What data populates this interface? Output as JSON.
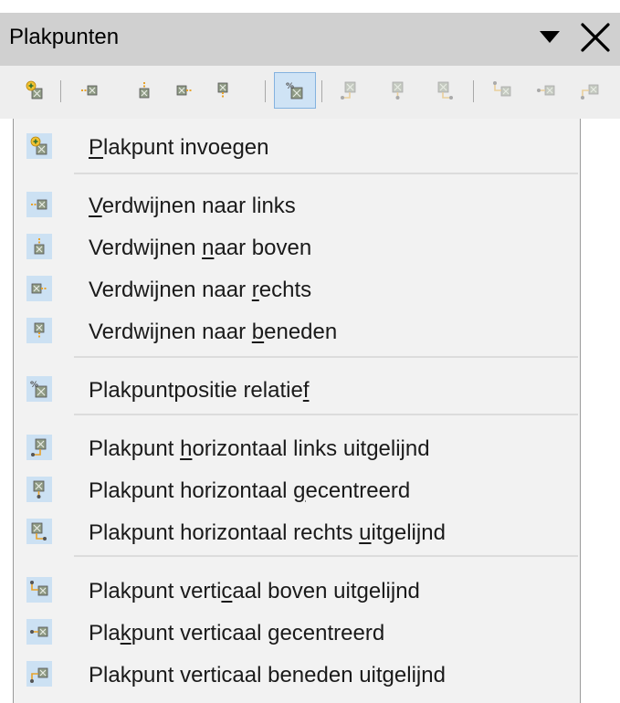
{
  "window": {
    "title": "Plakpunten",
    "dropdown_icon": "triangle-down-icon",
    "close_icon": "close-icon"
  },
  "toolbar": {
    "buttons": [
      {
        "name": "insert-point",
        "icon": "insert-gluepoint-icon",
        "enabled": true,
        "active": false
      },
      {
        "name": "exit-left",
        "icon": "exit-left-icon",
        "enabled": true,
        "active": false
      },
      {
        "name": "exit-top",
        "icon": "exit-top-icon",
        "enabled": true,
        "active": false
      },
      {
        "name": "exit-right",
        "icon": "exit-right-icon",
        "enabled": true,
        "active": false
      },
      {
        "name": "exit-bottom",
        "icon": "exit-bottom-icon",
        "enabled": true,
        "active": false
      },
      {
        "name": "relative-position",
        "icon": "relative-percent-icon",
        "enabled": true,
        "active": true
      },
      {
        "name": "h-left",
        "icon": "align-h-left-icon",
        "enabled": false,
        "active": false
      },
      {
        "name": "h-center",
        "icon": "align-h-center-icon",
        "enabled": false,
        "active": false
      },
      {
        "name": "h-right",
        "icon": "align-h-right-icon",
        "enabled": false,
        "active": false
      },
      {
        "name": "v-top",
        "icon": "align-v-top-icon",
        "enabled": false,
        "active": false
      },
      {
        "name": "v-center",
        "icon": "align-v-center-icon",
        "enabled": false,
        "active": false
      },
      {
        "name": "v-bottom",
        "icon": "align-v-bottom-icon",
        "enabled": false,
        "active": false
      }
    ]
  },
  "menu": {
    "items": [
      {
        "icon": "insert-gluepoint-icon",
        "pre": "",
        "u": "P",
        "post": "lakpunt invoegen"
      },
      {
        "icon": "exit-left-icon",
        "pre": "",
        "u": "V",
        "post": "erdwijnen naar links"
      },
      {
        "icon": "exit-top-icon",
        "pre": "Verdwijnen ",
        "u": "n",
        "post": "aar boven"
      },
      {
        "icon": "exit-right-icon",
        "pre": "Verdwijnen naar ",
        "u": "r",
        "post": "echts"
      },
      {
        "icon": "exit-bottom-icon",
        "pre": "Verdwijnen naar ",
        "u": "b",
        "post": "eneden"
      },
      {
        "icon": "relative-percent-icon",
        "pre": "Plakpuntpositie relatie",
        "u": "f",
        "post": ""
      },
      {
        "icon": "align-h-left-icon",
        "pre": "Plakpunt ",
        "u": "h",
        "post": "orizontaal links uitgelijnd"
      },
      {
        "icon": "align-h-center-icon",
        "pre": "Plakpunt horizontaal ",
        "u": "g",
        "post": "ecentreerd"
      },
      {
        "icon": "align-h-right-icon",
        "pre": "Plakpunt horizontaal rechts ",
        "u": "u",
        "post": "itgelijnd"
      },
      {
        "icon": "align-v-top-icon",
        "pre": "Plakpunt verti",
        "u": "c",
        "post": "aal boven uitgelijnd"
      },
      {
        "icon": "align-v-center-icon",
        "pre": "Pla",
        "u": "k",
        "post": "punt verticaal gecentreerd"
      },
      {
        "icon": "align-v-bottom-icon",
        "pre": "Plakpunt verticaal beneden uitgeli",
        "u": "j",
        "post": "nd"
      }
    ]
  },
  "colors": {
    "titlebar": "#d0d0d0",
    "toolbar": "#eeeeee",
    "menu_bg": "#f2f2f2",
    "icon_bg": "#cce1f3",
    "active_button": "#cfe3f5",
    "glue_green": "#8f9b85",
    "accent_orange": "#e7a22b"
  }
}
